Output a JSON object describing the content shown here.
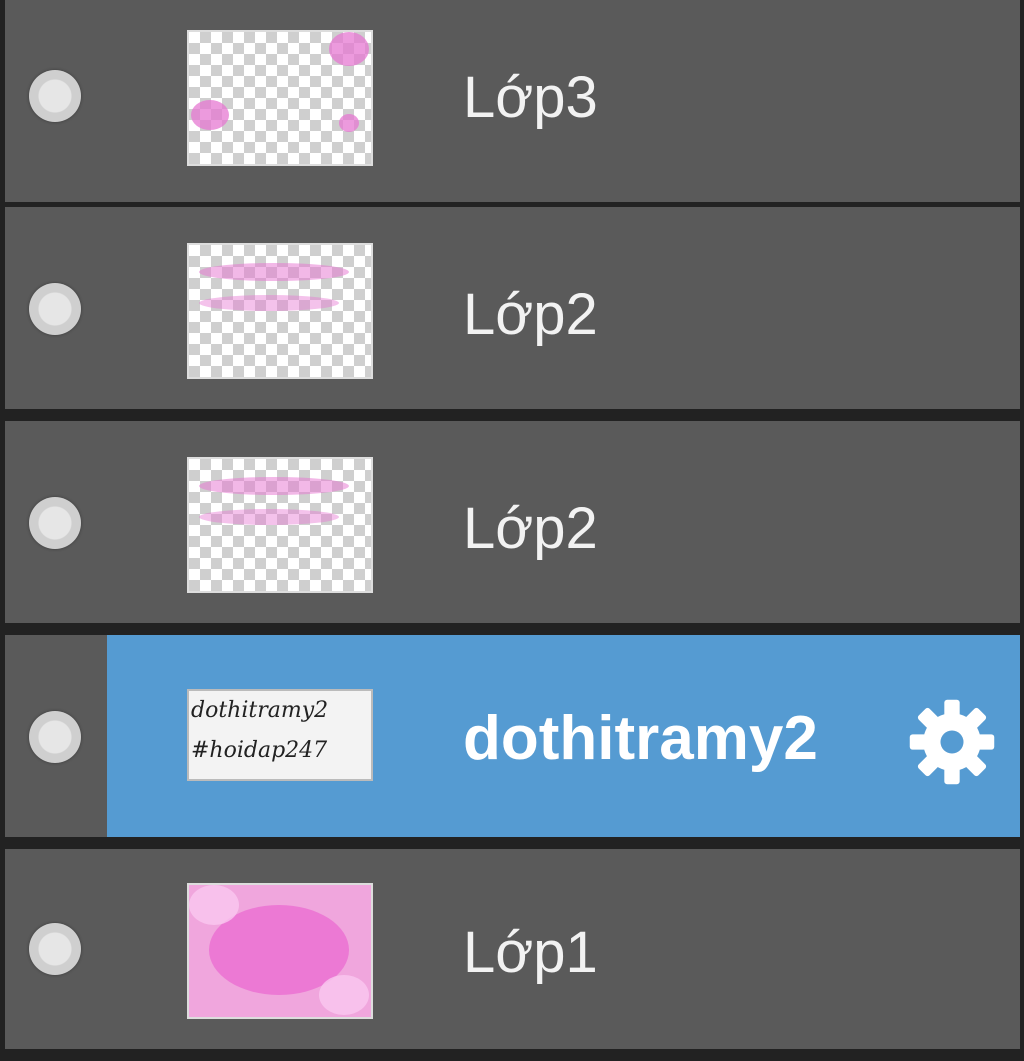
{
  "layers": [
    {
      "name": "Lớp3",
      "thumb": "sparse-pink"
    },
    {
      "name": "Lớp2",
      "thumb": "pink-text"
    },
    {
      "name": "Lớp2",
      "thumb": "pink-text"
    },
    {
      "name": "dothitramy2",
      "thumb": "text",
      "selected": true,
      "thumb_lines": [
        "dothitramy2",
        "#hoidap247"
      ],
      "settings_icon": "gear-icon"
    },
    {
      "name": "Lớp1",
      "thumb": "full-pink"
    }
  ],
  "colors": {
    "row_bg": "#5a5a5a",
    "separator": "#222222",
    "selected_bg": "#559bd2",
    "text": "#f2f2f2",
    "pink": "#e678d2"
  }
}
